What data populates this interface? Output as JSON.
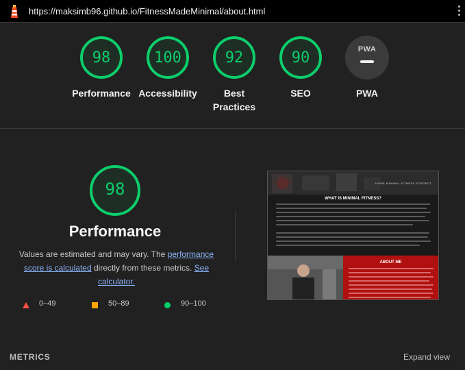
{
  "browser": {
    "url": "https://maksimb96.github.io/FitnessMadeMinimal/about.html"
  },
  "colors": {
    "pass": "#0cce6b",
    "average": "#ffa400",
    "fail": "#ff4e42",
    "link": "#8ab4f8"
  },
  "gauges": [
    {
      "score": 98,
      "label": "Performance"
    },
    {
      "score": 100,
      "label": "Accessibility"
    },
    {
      "score": 92,
      "label": "Best Practices"
    },
    {
      "score": 90,
      "label": "SEO"
    }
  ],
  "pwa": {
    "badge": "PWA",
    "label": "PWA"
  },
  "performance": {
    "score": 98,
    "title": "Performance",
    "desc_prefix": "Values are estimated and may vary. The ",
    "link1": "performance score is calculated",
    "desc_mid": " directly from these metrics. ",
    "link2": "See calculator."
  },
  "legend": [
    {
      "range": "0–49",
      "icon": "triangle-icon"
    },
    {
      "range": "50–89",
      "icon": "square-icon"
    },
    {
      "range": "90–100",
      "icon": "circle-icon"
    }
  ],
  "screenshot": {
    "nav": "HOME   MINIMAL FITNESS   CONTACT",
    "heading": "WHAT IS MINIMAL FITNESS?",
    "about_heading": "ABOUT ME"
  },
  "metrics": {
    "title": "METRICS",
    "expand": "Expand view"
  }
}
